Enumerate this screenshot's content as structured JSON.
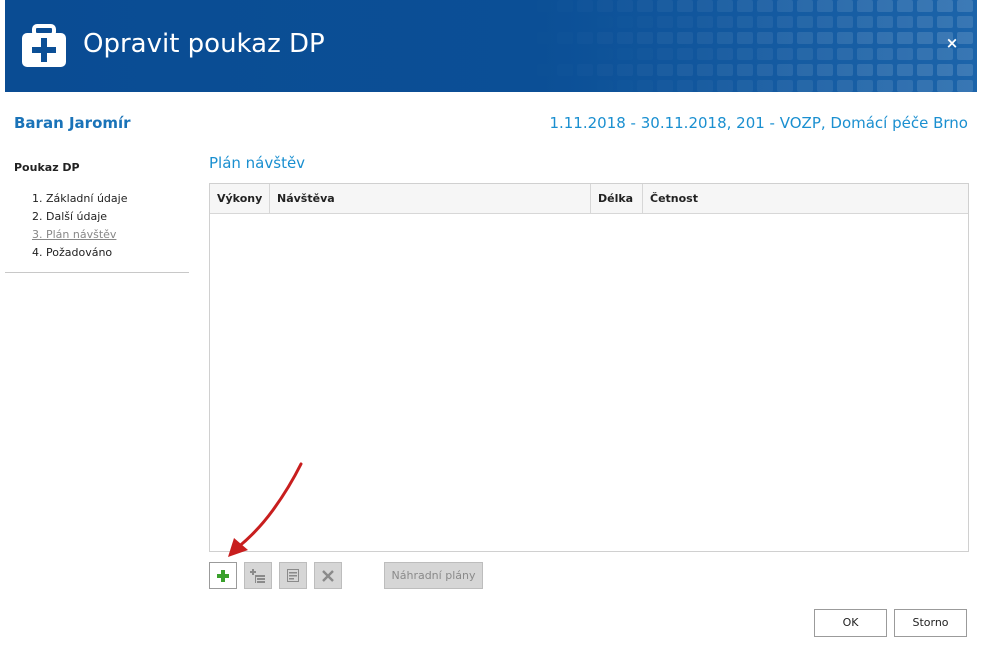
{
  "header": {
    "title": "Opravit poukaz DP",
    "close_label": "×",
    "icon": "medical-case-icon",
    "background_color": "#0b4f96"
  },
  "patient": {
    "name": "Baran Jaromír",
    "period": "1.11.2018 - 30.11.2018, 201 - VOZP, Domácí péče Brno"
  },
  "sidebar": {
    "title": "Poukaz DP",
    "items": [
      {
        "label": "1. Základní údaje",
        "active": false
      },
      {
        "label": "2. Další údaje",
        "active": false
      },
      {
        "label": "3. Plán návštěv",
        "active": true
      },
      {
        "label": "4. Požadováno",
        "active": false
      }
    ]
  },
  "main": {
    "section_title": "Plán návštěv",
    "table": {
      "columns": [
        "Výkony",
        "Návštěva",
        "Délka",
        "Četnost"
      ],
      "rows": []
    },
    "toolbar": {
      "buttons": [
        {
          "name": "add",
          "icon": "plus-icon",
          "enabled": true
        },
        {
          "name": "add-sub",
          "icon": "add-tree-icon",
          "enabled": false
        },
        {
          "name": "edit",
          "icon": "edit-icon",
          "enabled": false
        },
        {
          "name": "delete",
          "icon": "x-icon",
          "enabled": false
        }
      ],
      "alternate_plans_label": "Náhradní plány"
    }
  },
  "footer": {
    "ok_label": "OK",
    "cancel_label": "Storno"
  },
  "colors": {
    "accent": "#1a8fd0",
    "name": "#1a73b8",
    "annotation_arrow": "#c81e1e",
    "add_icon": "#3aa02c"
  }
}
